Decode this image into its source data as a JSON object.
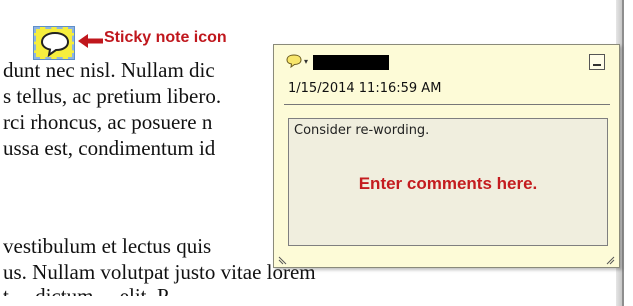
{
  "callout": {
    "label": "Sticky note icon",
    "color": "#c0171d"
  },
  "document": {
    "lines": [
      "dunt nec nisl. Nullam dic",
      "s tellus, ac pretium libero.",
      "rci rhoncus, ac posuere n",
      "ussa est, condimentum id",
      "vestibulum et lectus quis",
      "us. Nullam volutpat justo vitae lorem",
      "t ... dictum ... elit. P..."
    ]
  },
  "popup": {
    "icon": "speech-bubble-icon",
    "dropdown_glyph": "▾",
    "author_redacted": true,
    "timestamp": "1/15/2014 11:16:59 AM",
    "comment": "Consider re-wording.",
    "hint": "Enter comments here.",
    "hint_color": "#c41c1f",
    "background": "#fdfbd7"
  },
  "sticky_icon": {
    "icon": "sticky-note-icon",
    "color": "#f6ee3e"
  }
}
